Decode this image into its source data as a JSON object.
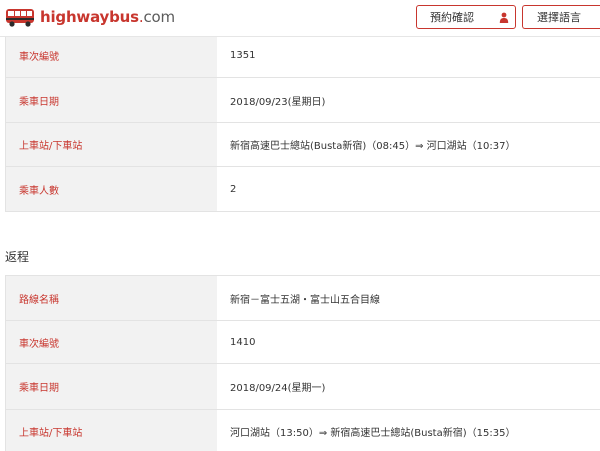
{
  "header": {
    "brand": "highwaybus",
    "brand_dot": ".",
    "brand_tld": "com",
    "booking_button": "預約確認",
    "language_button": "選擇語言"
  },
  "outbound": {
    "rows": [
      {
        "label": "車次編號",
        "value": "1351"
      },
      {
        "label": "乘車日期",
        "value": "2018/09/23(星期日)"
      },
      {
        "label": "上車站/下車站",
        "value": "新宿高速巴士總站(Busta新宿)（08:45）⇒ 河口湖站（10:37）"
      },
      {
        "label": "乘車人數",
        "value": "2"
      }
    ]
  },
  "return": {
    "title": "返程",
    "rows": [
      {
        "label": "路線名稱",
        "value": "新宿－富士五湖・富士山五合目線"
      },
      {
        "label": "車次編號",
        "value": "1410"
      },
      {
        "label": "乘車日期",
        "value": "2018/09/24(星期一)"
      },
      {
        "label": "上車站/下車站",
        "value": "河口湖站（13:50）⇒ 新宿高速巴士總站(Busta新宿)（15:35）"
      }
    ]
  },
  "colors": {
    "accent": "#c8362e",
    "label_bg": "#f2f2f2",
    "border": "#e3e3e3",
    "text": "#333333"
  },
  "icons": {
    "logo": "bus-icon",
    "booking": "user-icon"
  }
}
